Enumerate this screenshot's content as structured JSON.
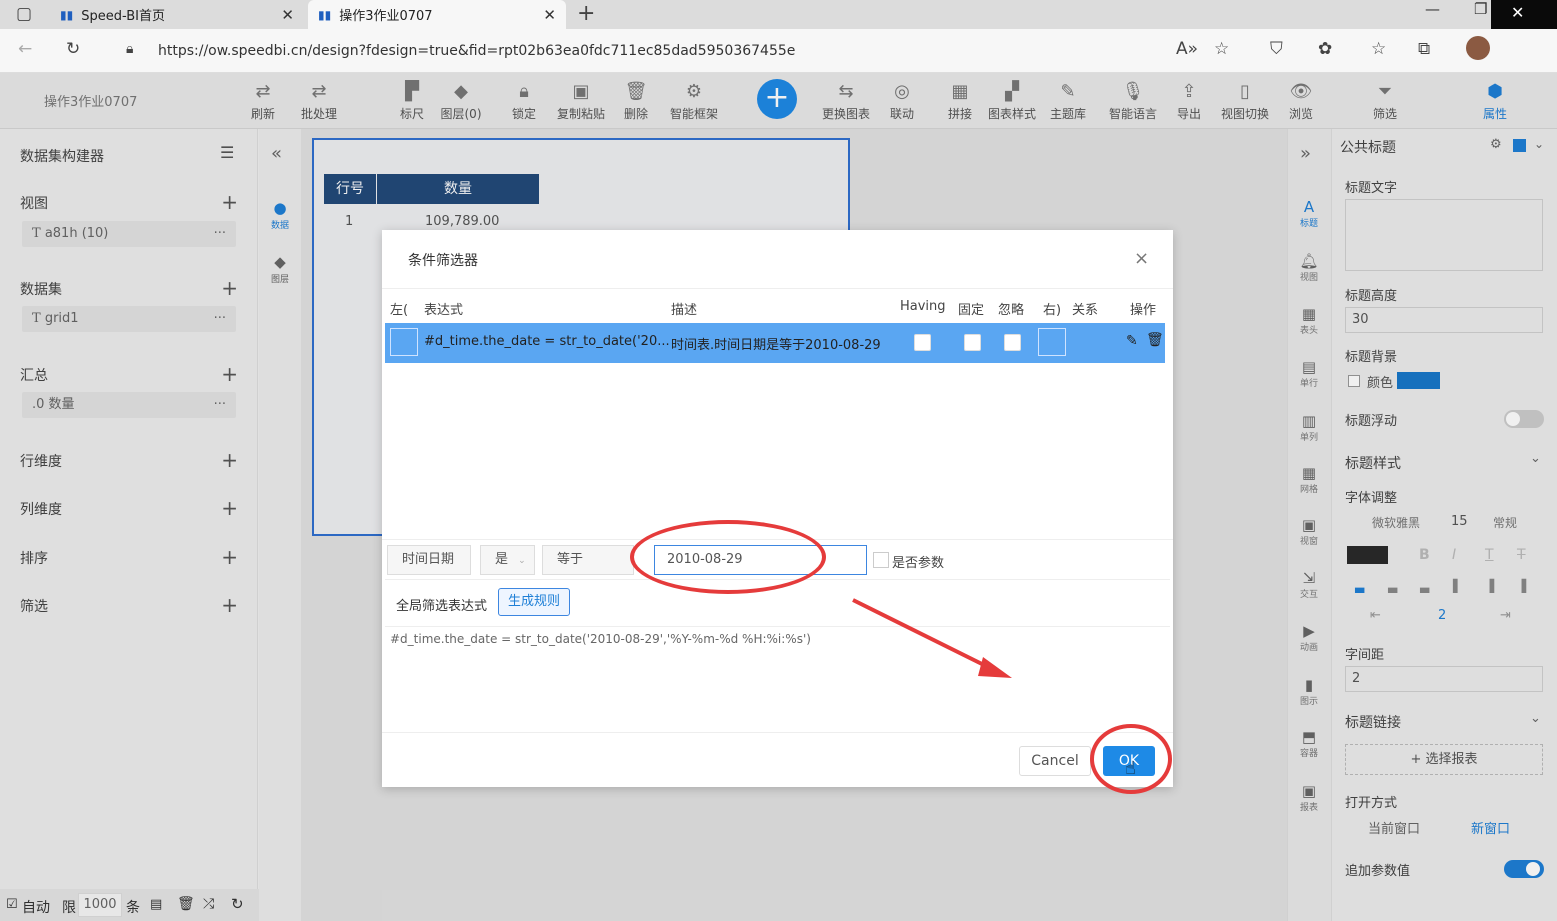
{
  "browser": {
    "tabs": [
      {
        "label": "Speed-BI首页"
      },
      {
        "label": "操作3作业0707"
      }
    ],
    "new_tab": "+",
    "url": "https://ow.speedbi.cn/design?fdesign=true&fid=rpt02b63ea0fdc711ec85dad5950367455e"
  },
  "app": {
    "doc_title": "操作3作业0707",
    "toolbar": [
      {
        "icon": "refresh-icon",
        "label": "刷新"
      },
      {
        "icon": "batch-icon",
        "label": "批处理"
      },
      {
        "icon": "ruler-icon",
        "label": "标尺"
      },
      {
        "icon": "layers-icon",
        "label": "图层(0)"
      },
      {
        "icon": "lock-icon",
        "label": "锁定"
      },
      {
        "icon": "copy-paste-icon",
        "label": "复制粘贴"
      },
      {
        "icon": "delete-icon",
        "label": "删除"
      },
      {
        "icon": "smart-frame-icon",
        "label": "智能框架"
      },
      {
        "icon": "change-chart-icon",
        "label": "更换图表"
      },
      {
        "icon": "link-icon",
        "label": "联动"
      },
      {
        "icon": "splice-icon",
        "label": "拼接"
      },
      {
        "icon": "chart-style-icon",
        "label": "图表样式"
      },
      {
        "icon": "theme-icon",
        "label": "主题库"
      },
      {
        "icon": "voice-icon",
        "label": "智能语言"
      },
      {
        "icon": "export-icon",
        "label": "导出"
      },
      {
        "icon": "view-switch-icon",
        "label": "视图切换"
      },
      {
        "icon": "preview-icon",
        "label": "浏览"
      },
      {
        "icon": "filter-icon",
        "label": "筛选"
      },
      {
        "icon": "property-icon",
        "label": "属性"
      }
    ],
    "add_symbol": "+"
  },
  "leftpanel": {
    "header": "数据集构建器",
    "sections": [
      {
        "label": "视图",
        "item": "a81h (10)"
      },
      {
        "label": "数据集",
        "item": "grid1"
      },
      {
        "label": "汇总",
        "item": "数量"
      },
      {
        "label": "行维度"
      },
      {
        "label": "列维度"
      },
      {
        "label": "排序"
      },
      {
        "label": "筛选"
      }
    ],
    "item_prefix_t": "T",
    "item_prefix_0": ".0",
    "more": "···",
    "plus": "+",
    "tabs": [
      "数据",
      "图层"
    ]
  },
  "bottombar": {
    "auto": "自动",
    "limit": "限",
    "limit_value": "1000",
    "unit": "条"
  },
  "report": {
    "headers": [
      "行号",
      "数量"
    ],
    "row": {
      "num": "1",
      "value": "109,789.00"
    }
  },
  "dialog": {
    "title": "条件筛选器",
    "close": "×",
    "columns": {
      "left": "左(",
      "expr": "表达式",
      "desc": "描述",
      "having": "Having",
      "fixed": "固定",
      "ignore": "忽略",
      "right": "右)",
      "relation": "关系",
      "action": "操作"
    },
    "row": {
      "expr": "#d_time.the_date = str_to_date('20...",
      "desc": "时间表.时间日期是等于2010-08-29"
    },
    "condition": {
      "field": "时间日期",
      "is": "是",
      "op": "等于",
      "value": "2010-08-29",
      "param_label": "是否参数"
    },
    "global_label": "全局筛选表达式",
    "generate_btn": "生成规则",
    "expression": "#d_time.the_date = str_to_date('2010-08-29','%Y-%m-%d %H:%i:%s')",
    "cancel": "Cancel",
    "ok": "OK"
  },
  "rightpanel": {
    "header": "公共标题",
    "title_text_label": "标题文字",
    "title_height_label": "标题高度",
    "title_height_value": "30",
    "title_bg_label": "标题背景",
    "color_label": "颜色",
    "title_float_label": "标题浮动",
    "title_style_label": "标题样式",
    "font_adjust_label": "字体调整",
    "font_name": "微软雅黑",
    "font_size": "15",
    "font_weight": "常规",
    "spacing_value": "2",
    "letter_spacing_label": "字间距",
    "letter_spacing_value": "2",
    "title_link_label": "标题链接",
    "select_report_btn": "+ 选择报表",
    "open_mode_label": "打开方式",
    "open_current": "当前窗口",
    "open_new": "新窗口",
    "append_param_label": "追加参数值",
    "accent_color": "#1e7fd6",
    "strip_icons": [
      "标题",
      "视图",
      "表头",
      "单行",
      "单列",
      "网格",
      "视窗",
      "交互",
      "动画",
      "图示",
      "容器",
      "报表"
    ]
  }
}
